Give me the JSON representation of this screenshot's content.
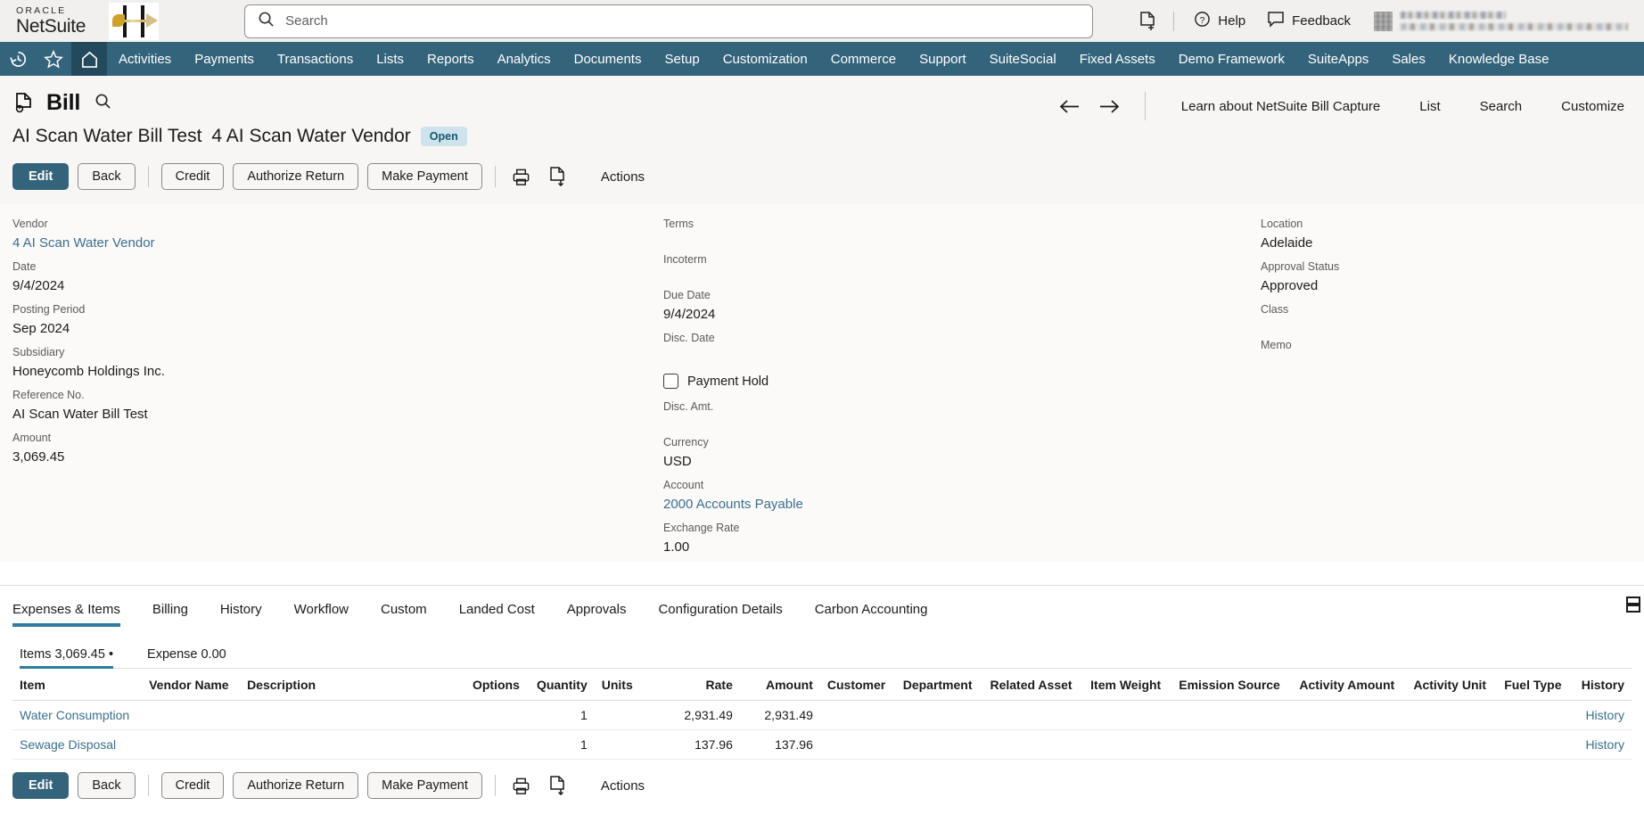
{
  "header": {
    "brand_oracle": "ORACLE",
    "brand_netsuite": "NetSuite",
    "search_placeholder": "Search",
    "new_doc_icon": "new-document-icon",
    "help_label": "Help",
    "feedback_label": "Feedback"
  },
  "nav": {
    "history_icon": "history-clock-icon",
    "favorites_icon": "star-icon",
    "home_icon": "home-icon",
    "items": [
      {
        "label": "Activities"
      },
      {
        "label": "Payments"
      },
      {
        "label": "Transactions"
      },
      {
        "label": "Lists"
      },
      {
        "label": "Reports"
      },
      {
        "label": "Analytics"
      },
      {
        "label": "Documents"
      },
      {
        "label": "Setup"
      },
      {
        "label": "Customization"
      },
      {
        "label": "Commerce"
      },
      {
        "label": "Support"
      },
      {
        "label": "SuiteSocial"
      },
      {
        "label": "Fixed Assets"
      },
      {
        "label": "Demo Framework"
      },
      {
        "label": "SuiteApps"
      },
      {
        "label": "Sales"
      },
      {
        "label": "Knowledge Base"
      }
    ]
  },
  "record": {
    "type": "Bill",
    "name": "AI Scan Water Bill Test",
    "vendor": "4 AI Scan Water Vendor",
    "status": "Open",
    "header_actions": [
      {
        "label": "Learn about NetSuite Bill Capture"
      },
      {
        "label": "List"
      },
      {
        "label": "Search"
      },
      {
        "label": "Customize"
      }
    ]
  },
  "toolbar": {
    "edit": "Edit",
    "back": "Back",
    "credit": "Credit",
    "authorize_return": "Authorize Return",
    "make_payment": "Make Payment",
    "print_icon": "printer-icon",
    "export_icon": "export-document-icon",
    "actions": "Actions"
  },
  "fields": {
    "col1": [
      {
        "label": "Vendor",
        "value": "4 AI Scan Water Vendor",
        "link": true
      },
      {
        "label": "Date",
        "value": "9/4/2024"
      },
      {
        "label": "Posting Period",
        "value": "Sep 2024"
      },
      {
        "label": "Subsidiary",
        "value": "Honeycomb Holdings Inc."
      },
      {
        "label": "Reference No.",
        "value": "AI Scan Water Bill Test"
      },
      {
        "label": "Amount",
        "value": "3,069.45"
      }
    ],
    "col2_top": [
      {
        "label": "Terms",
        "value": ""
      },
      {
        "label": "Incoterm",
        "value": ""
      },
      {
        "label": "Due Date",
        "value": "9/4/2024"
      },
      {
        "label": "Disc. Date",
        "value": ""
      }
    ],
    "payment_hold": {
      "label": "Payment Hold",
      "checked": false
    },
    "col2_bottom": [
      {
        "label": "Disc. Amt.",
        "value": ""
      },
      {
        "label": "Currency",
        "value": "USD"
      },
      {
        "label": "Account",
        "value": "2000 Accounts Payable",
        "link": true
      },
      {
        "label": "Exchange Rate",
        "value": "1.00"
      }
    ],
    "col3": [
      {
        "label": "Location",
        "value": "Adelaide"
      },
      {
        "label": "Approval Status",
        "value": "Approved"
      },
      {
        "label": "Class",
        "value": ""
      },
      {
        "label": "Memo",
        "value": ""
      }
    ]
  },
  "subtabs": [
    {
      "label": "Expenses & Items",
      "active": true
    },
    {
      "label": "Billing",
      "active": false
    },
    {
      "label": "History",
      "active": false
    },
    {
      "label": "Workflow",
      "active": false
    },
    {
      "label": "Custom",
      "active": false
    },
    {
      "label": "Landed Cost",
      "active": false
    },
    {
      "label": "Approvals",
      "active": false
    },
    {
      "label": "Configuration Details",
      "active": false
    },
    {
      "label": "Carbon Accounting",
      "active": false
    }
  ],
  "subtab_right_icon": "list-view-icon",
  "item_tabs": [
    {
      "label": "Items 3,069.45 •",
      "active": true
    },
    {
      "label": "Expense 0.00",
      "active": false
    }
  ],
  "items_table": {
    "columns": [
      {
        "label": "Item",
        "align": "left"
      },
      {
        "label": "Vendor Name",
        "align": "left"
      },
      {
        "label": "Description",
        "align": "left"
      },
      {
        "label": "Options",
        "align": "right"
      },
      {
        "label": "Quantity",
        "align": "right"
      },
      {
        "label": "Units",
        "align": "left"
      },
      {
        "label": "Rate",
        "align": "right"
      },
      {
        "label": "Amount",
        "align": "right"
      },
      {
        "label": "Customer",
        "align": "left"
      },
      {
        "label": "Department",
        "align": "left"
      },
      {
        "label": "Related Asset",
        "align": "left"
      },
      {
        "label": "Item Weight",
        "align": "left"
      },
      {
        "label": "Emission Source",
        "align": "left"
      },
      {
        "label": "Activity Amount",
        "align": "left"
      },
      {
        "label": "Activity Unit",
        "align": "left"
      },
      {
        "label": "Fuel Type",
        "align": "left"
      },
      {
        "label": "History",
        "align": "right"
      }
    ],
    "rows": [
      {
        "item": "Water Consumption",
        "vendor_name": "",
        "description": "",
        "options": "",
        "quantity": "1",
        "units": "",
        "rate": "2,931.49",
        "amount": "2,931.49",
        "customer": "",
        "department": "",
        "related_asset": "",
        "item_weight": "",
        "emission_source": "",
        "activity_amount": "",
        "activity_unit": "",
        "fuel_type": "",
        "history": "History"
      },
      {
        "item": "Sewage Disposal",
        "vendor_name": "",
        "description": "",
        "options": "",
        "quantity": "1",
        "units": "",
        "rate": "137.96",
        "amount": "137.96",
        "customer": "",
        "department": "",
        "related_asset": "",
        "item_weight": "",
        "emission_source": "",
        "activity_amount": "",
        "activity_unit": "",
        "fuel_type": "",
        "history": "History"
      }
    ]
  },
  "colors": {
    "nav_bg": "#34647b",
    "accent": "#2e7ca1",
    "link": "#3a6f8f",
    "badge_bg": "#cfe3ec",
    "badge_text": "#15566e"
  }
}
